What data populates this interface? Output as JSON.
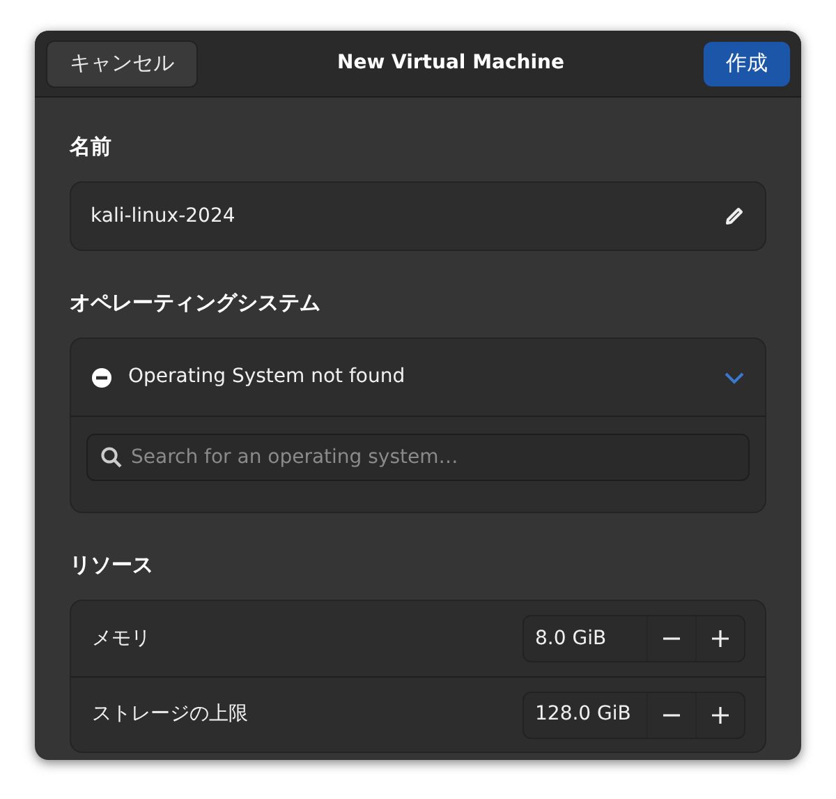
{
  "header": {
    "cancel": "キャンセル",
    "title": "New Virtual Machine",
    "create": "作成"
  },
  "name_section": {
    "heading": "名前",
    "value": "kali-linux-2024"
  },
  "os_section": {
    "heading": "オペレーティングシステム",
    "status": "Operating System not found",
    "expanded": true,
    "search": {
      "placeholder": "Search for an operating system…"
    }
  },
  "resources_section": {
    "heading": "リソース",
    "rows": [
      {
        "label": "メモリ",
        "value": "8.0 GiB"
      },
      {
        "label": "ストレージの上限",
        "value": "128.0 GiB"
      }
    ]
  }
}
